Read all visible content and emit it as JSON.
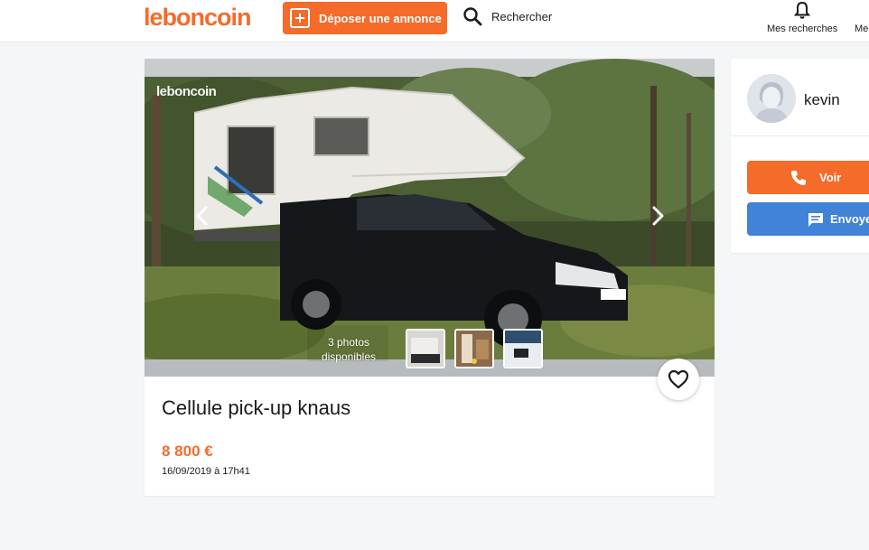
{
  "header": {
    "logo": "leboncoin",
    "post_label": "Déposer une annonce",
    "search_label": "Rechercher",
    "saved_searches_label": "Mes recherches",
    "next_label": "Me"
  },
  "listing": {
    "watermark": "leboncoin",
    "photos_count_line1": "3 photos",
    "photos_count_line2": "disponibles",
    "title": "Cellule pick-up knaus",
    "price": "8 800 €",
    "date": "16/09/2019 à 17h41"
  },
  "seller": {
    "name": "kevin",
    "phone_label": "Voir",
    "message_label": "Envoyer"
  },
  "colors": {
    "brand": "#f56b2a",
    "message_blue": "#4183d7"
  }
}
